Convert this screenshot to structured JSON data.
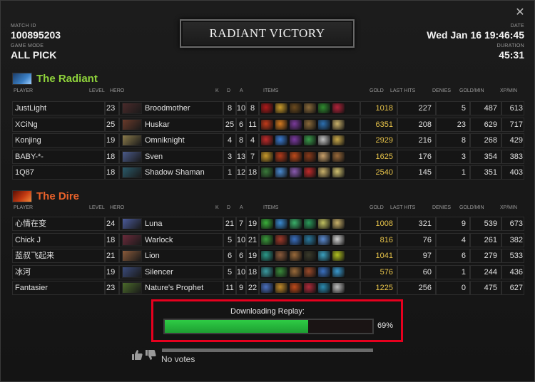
{
  "match": {
    "match_id_label": "MATCH ID",
    "match_id": "100895203",
    "game_mode_label": "GAME MODE",
    "game_mode": "ALL PICK",
    "date_label": "DATE",
    "date": "Wed Jan 16 19:46:45",
    "duration_label": "DURATION",
    "duration": "45:31",
    "banner": "RADIANT VICTORY"
  },
  "columns": {
    "player": "PLAYER",
    "level": "LEVEL",
    "hero": "HERO",
    "k": "K",
    "d": "D",
    "a": "A",
    "items": "ITEMS",
    "gold": "GOLD",
    "last_hits": "LAST HITS",
    "denies": "DENIES",
    "gpm": "GOLD/MIN",
    "xpm": "XP/MIN"
  },
  "radiant": {
    "name": "The Radiant",
    "color": "#8fd33b",
    "players": [
      {
        "player": "JustLight",
        "level": "23",
        "hero": "Broodmother",
        "k": "8",
        "d": "10",
        "a": "8",
        "gold": "1018",
        "last_hits": "227",
        "denies": "5",
        "gpm": "487",
        "xpm": "613"
      },
      {
        "player": "XCiNg",
        "level": "25",
        "hero": "Huskar",
        "k": "25",
        "d": "6",
        "a": "11",
        "gold": "6351",
        "last_hits": "208",
        "denies": "23",
        "gpm": "629",
        "xpm": "717"
      },
      {
        "player": "Konjing",
        "level": "19",
        "hero": "Omniknight",
        "k": "4",
        "d": "8",
        "a": "4",
        "gold": "2929",
        "last_hits": "216",
        "denies": "8",
        "gpm": "268",
        "xpm": "429"
      },
      {
        "player": "BABY-*-",
        "level": "18",
        "hero": "Sven",
        "k": "3",
        "d": "13",
        "a": "7",
        "gold": "1625",
        "last_hits": "176",
        "denies": "3",
        "gpm": "354",
        "xpm": "383"
      },
      {
        "player": "1Q87",
        "level": "18",
        "hero": "Shadow Shaman",
        "k": "1",
        "d": "12",
        "a": "18",
        "gold": "2540",
        "last_hits": "145",
        "denies": "1",
        "gpm": "351",
        "xpm": "403"
      }
    ]
  },
  "dire": {
    "name": "The Dire",
    "color": "#e8612a",
    "players": [
      {
        "player": "心情在变",
        "level": "24",
        "hero": "Luna",
        "k": "21",
        "d": "7",
        "a": "19",
        "gold": "1008",
        "last_hits": "321",
        "denies": "9",
        "gpm": "539",
        "xpm": "673"
      },
      {
        "player": "Chick J",
        "level": "18",
        "hero": "Warlock",
        "k": "5",
        "d": "10",
        "a": "21",
        "gold": "816",
        "last_hits": "76",
        "denies": "4",
        "gpm": "261",
        "xpm": "382"
      },
      {
        "player": "蓝叔飞起来",
        "level": "21",
        "hero": "Lion",
        "k": "6",
        "d": "6",
        "a": "19",
        "gold": "1041",
        "last_hits": "97",
        "denies": "6",
        "gpm": "279",
        "xpm": "533"
      },
      {
        "player": "冰河",
        "level": "19",
        "hero": "Silencer",
        "k": "5",
        "d": "10",
        "a": "18",
        "gold": "576",
        "last_hits": "60",
        "denies": "1",
        "gpm": "244",
        "xpm": "436"
      },
      {
        "player": "Fantasier",
        "level": "23",
        "hero": "Nature's Prophet",
        "k": "11",
        "d": "9",
        "a": "22",
        "gold": "1225",
        "last_hits": "256",
        "denies": "0",
        "gpm": "475",
        "xpm": "627"
      }
    ]
  },
  "download": {
    "label": "Downloading Replay:",
    "percent_text": "69%",
    "progress": 0.69,
    "fill_color": "#2ecc45",
    "highlight_color": "#e6001e"
  },
  "votes": {
    "text": "No votes",
    "icons": [
      "thumbs-up-icon",
      "thumbs-down-icon"
    ]
  },
  "icons": {
    "close": "close-icon"
  }
}
